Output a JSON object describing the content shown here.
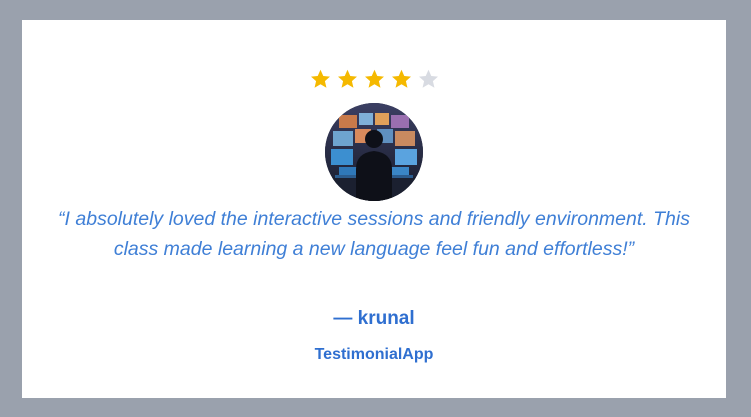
{
  "testimonial": {
    "rating": 4,
    "max_rating": 5,
    "quote": "“I absolutely loved the interactive sessions and friendly environment. This class made learning a new language feel fun and effortless!”",
    "author": "— krunal",
    "brand": "TestimonialApp",
    "avatar_icon": "person-at-monitors-avatar"
  },
  "colors": {
    "background": "#9aa1ad",
    "card": "#ffffff",
    "star_filled": "#f5b900",
    "star_empty": "#d8dbe2",
    "text_accent": "#3f7fd6",
    "brand_text": "#2f6fd0"
  }
}
